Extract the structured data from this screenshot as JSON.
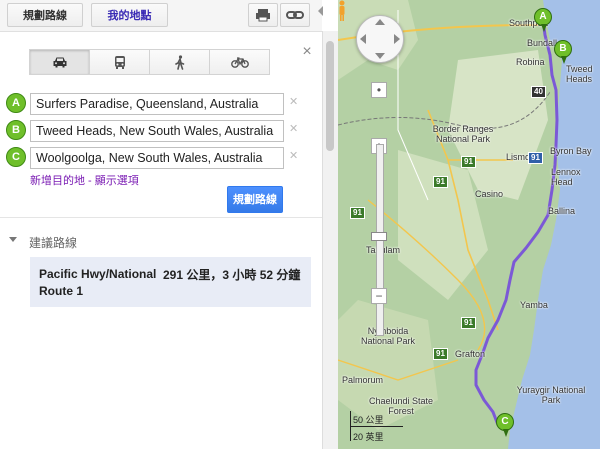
{
  "topbar": {
    "directions_label": "規劃路線",
    "my_maps_label": "我的地點"
  },
  "modes": [
    {
      "name": "car-icon",
      "selected": true
    },
    {
      "name": "bus-icon",
      "selected": false
    },
    {
      "name": "walk-icon",
      "selected": false
    },
    {
      "name": "bike-icon",
      "selected": false
    }
  ],
  "waypoints": [
    {
      "marker": "A",
      "value": "Surfers Paradise, Queensland, Australia"
    },
    {
      "marker": "B",
      "value": "Tweed Heads, New South Wales, Australia"
    },
    {
      "marker": "C",
      "value": "Woolgoolga, New South Wales, Australia"
    }
  ],
  "add_destination": "新增目的地",
  "show_options": "顯示選項",
  "options_separator": " - ",
  "get_directions_label": "規劃路線",
  "routes": {
    "title": "建議路線",
    "route_name": "Pacific Hwy/National Route 1",
    "summary": "291 公里，3 小時 52 分鐘"
  },
  "map": {
    "places": [
      "Southport",
      "Bundall",
      "Robina",
      "Tweed Heads",
      "Border Ranges National Park",
      "Byron Bay",
      "Lennox Head",
      "Ballina",
      "Lismore",
      "Casino",
      "Yamba",
      "Nymboida National Park",
      "Grafton",
      "Yuraygir National Park",
      "Chaelundi State Forest",
      "Tabulam",
      "Palmorum"
    ],
    "shields": [
      "40",
      "91",
      "91",
      "91",
      "91",
      "91",
      "91"
    ],
    "markers": [
      "A",
      "B",
      "C"
    ],
    "scale_metric": "50 公里",
    "scale_imperial": "20 英里",
    "route_color": "#7b59d6"
  }
}
